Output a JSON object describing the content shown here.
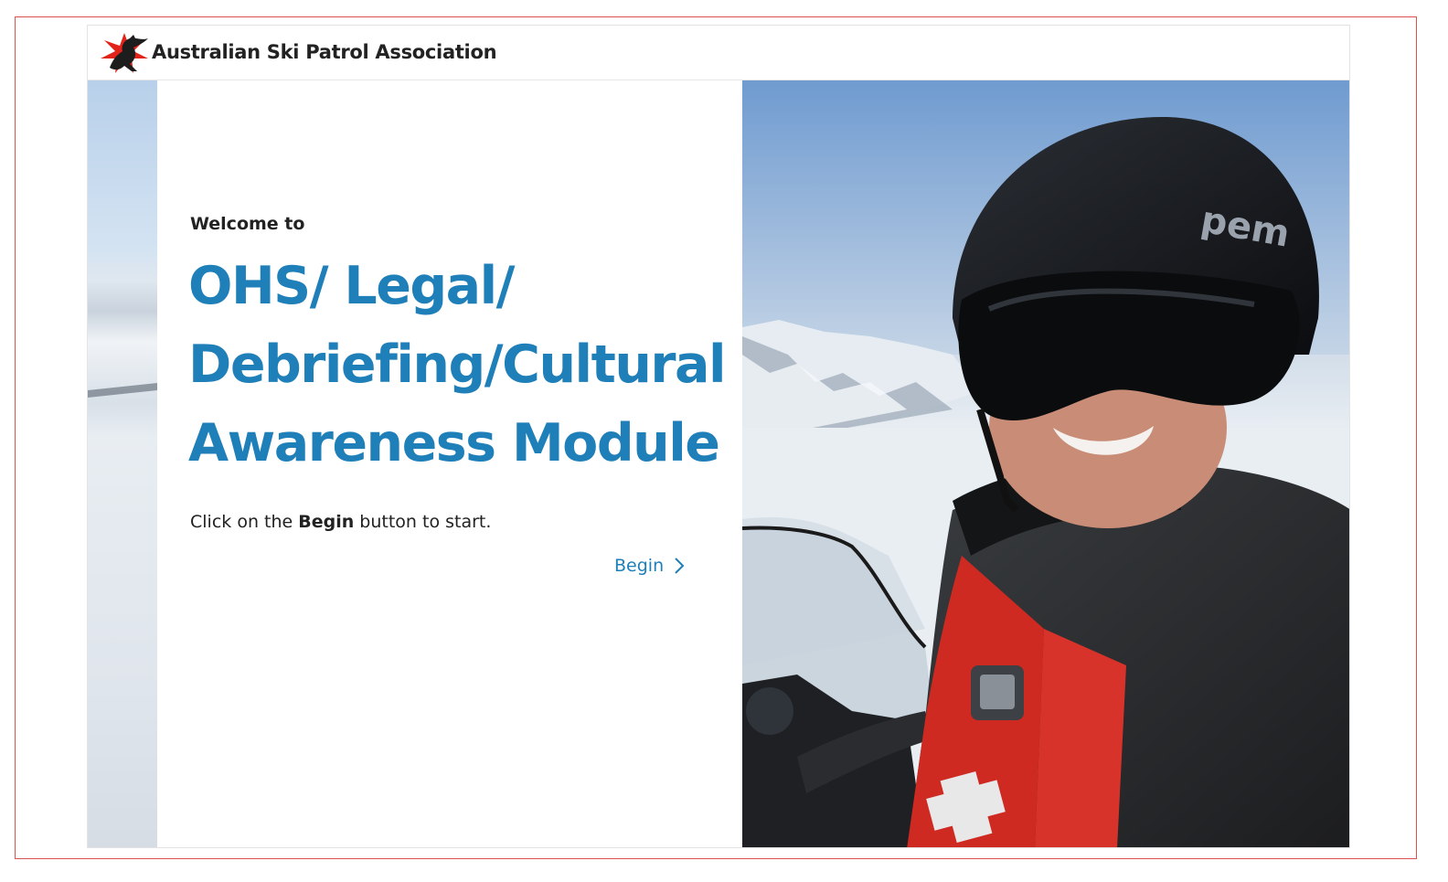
{
  "header": {
    "org_name": "Australian Ski Patrol Association",
    "logo_icon": "kangaroo-star-logo"
  },
  "main": {
    "welcome": "Welcome to",
    "title_lines": [
      "OHS/ Legal/",
      "Debriefing/Cultural",
      "Awareness Module"
    ],
    "instruction_prefix": "Click on the ",
    "instruction_bold": "Begin",
    "instruction_suffix": " button to start.",
    "begin_label": "Begin",
    "begin_icon": "chevron-right-icon"
  },
  "colors": {
    "accent": "#1f7fb8",
    "text": "#222222",
    "frame": "#d9534f",
    "logo_red": "#e2231a"
  }
}
